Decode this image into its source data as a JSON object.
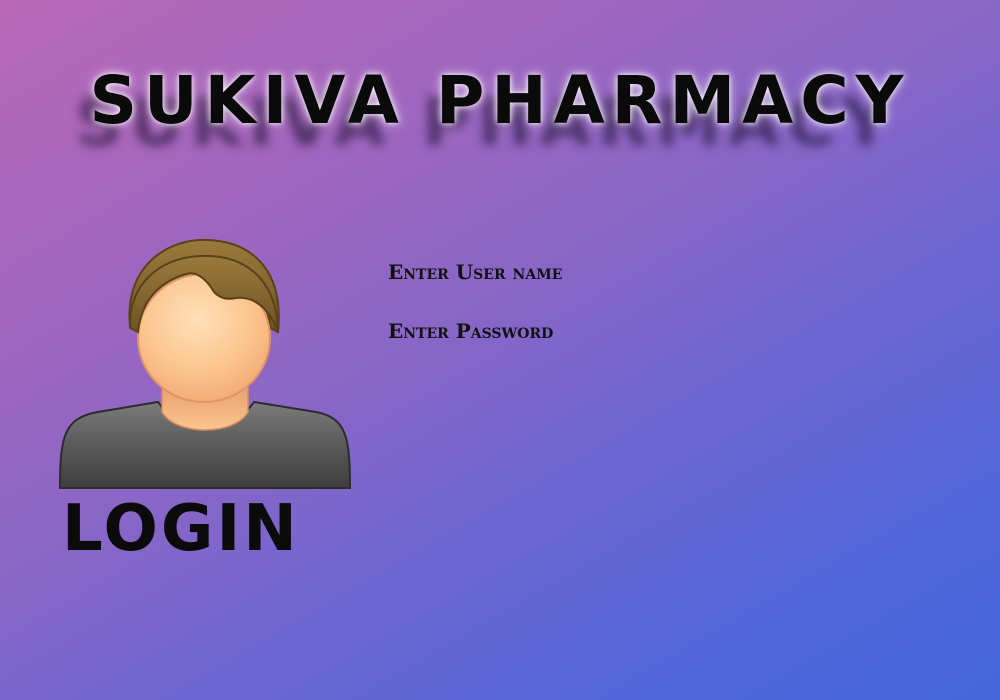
{
  "app": {
    "title": "SUKIVA PHARMACY"
  },
  "login_form": {
    "heading": "LOGIN",
    "username_label": "Enter User name",
    "password_label": "Enter Password",
    "avatar_icon": "user-avatar-icon"
  },
  "colors": {
    "background_start": "#b868b8",
    "background_end": "#4567dc",
    "title_text": "#0a0a0a"
  }
}
